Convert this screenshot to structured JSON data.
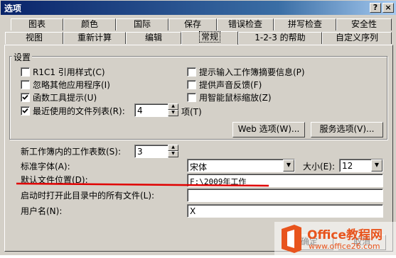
{
  "window": {
    "title": "选项",
    "help_button": "?",
    "close_button": "×"
  },
  "tabs_row1": [
    "图表",
    "颜色",
    "国际",
    "保存",
    "错误检查",
    "拼写检查",
    "安全性"
  ],
  "tabs_row2": [
    "视图",
    "重新计算",
    "编辑",
    "常规",
    "1-2-3 的帮助",
    "自定义序列"
  ],
  "active_tab": "常规",
  "settings": {
    "group_label": "设置",
    "left_checks": [
      {
        "label": "R1C1 引用样式(C)",
        "checked": false
      },
      {
        "label": "忽略其他应用程序(I)",
        "checked": false
      },
      {
        "label": "函数工具提示(U)",
        "checked": true
      },
      {
        "label": "最近使用的文件列表(R):",
        "checked": true
      }
    ],
    "right_checks": [
      {
        "label": "提示输入工作簿摘要信息(P)",
        "checked": false
      },
      {
        "label": "提供声音反馈(F)",
        "checked": false
      },
      {
        "label": "用智能鼠标缩放(Z)",
        "checked": false
      }
    ],
    "recent_count": "4",
    "recent_unit": "项(T)",
    "web_options_button": "Web 选项(W)...",
    "service_options_button": "服务选项(V)..."
  },
  "general": {
    "sheets_label": "新工作簿内的工作表数(S):",
    "sheets_value": "3",
    "font_label": "标准字体(A):",
    "font_value": "宋体",
    "size_label": "大小(E):",
    "size_value": "12",
    "default_location_label": "默认文件位置(D):",
    "default_location_value": "F:\\2009年工作",
    "startup_label": "启动时打开此目录中的所有文件(L):",
    "startup_value": "",
    "username_label": "用户名(N):",
    "username_value": "X"
  },
  "buttons": {
    "ok": "确定",
    "cancel": "取消"
  },
  "watermark": {
    "brand": "Office教程网",
    "url": "www.office26.com"
  },
  "colors": {
    "titlebar": "#0a246a",
    "face": "#d4d0c8",
    "annotation": "#e00000",
    "watermark": "#e8541d"
  }
}
